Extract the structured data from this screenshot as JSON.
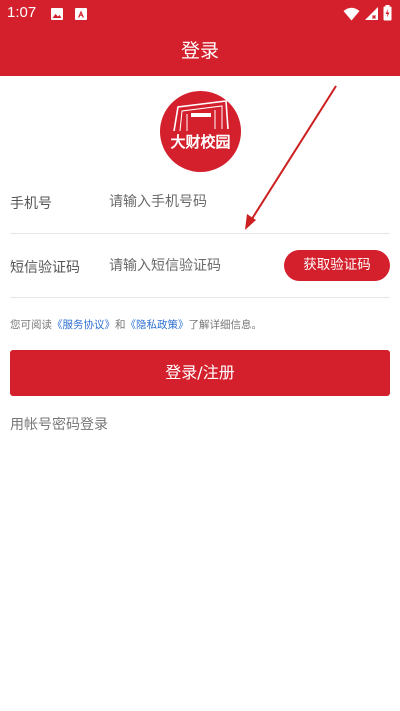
{
  "status_bar": {
    "time": "1:07",
    "left_icons": [
      "image-icon",
      "text-icon"
    ],
    "right_icons": [
      "wifi-icon",
      "signal-icon",
      "battery-icon"
    ]
  },
  "header": {
    "title": "登录"
  },
  "logo": {
    "text": "大财校园",
    "accent_color": "#d41f2c"
  },
  "phone_row": {
    "label": "手机号",
    "placeholder": "请输入手机号码",
    "value": ""
  },
  "code_row": {
    "label": "短信验证码",
    "placeholder": "请输入短信验证码",
    "value": "",
    "button_label": "获取验证码"
  },
  "agreement": {
    "prefix": "您可阅读",
    "service_link": "《服务协议》",
    "connector": "和",
    "privacy_link": "《隐私政策》",
    "suffix": "了解详细信息。",
    "link_color": "#2f6fd1"
  },
  "login_button": {
    "label": "登录/注册"
  },
  "password_login": {
    "label": "用帐号密码登录"
  },
  "colors": {
    "brand": "#d41f2c",
    "annotation_arrow": "#cc1f1f"
  }
}
